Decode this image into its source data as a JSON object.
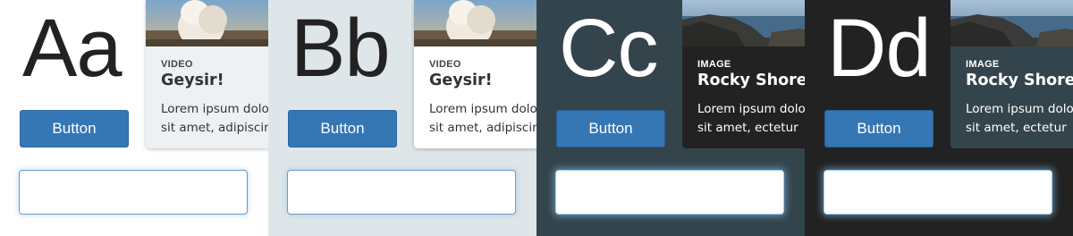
{
  "panels": [
    {
      "glyph": "Aa",
      "button_label": "Button",
      "card": {
        "kind": "VIDEO",
        "title": "Geysir!",
        "body_line1": "Lorem ipsum dolo",
        "body_line2": "sit amet, adipiscin",
        "image": "geyser-photo"
      },
      "colors": {
        "background": "#ffffff",
        "text": "#222222",
        "card_bg": "#eef1f4",
        "button": "#3576b5",
        "field_border": "#6a9cc9"
      }
    },
    {
      "glyph": "Bb",
      "button_label": "Button",
      "card": {
        "kind": "VIDEO",
        "title": "Geysir!",
        "body_line1": "Lorem ipsum dolo",
        "body_line2": "sit amet, adipiscin",
        "image": "geyser-photo"
      },
      "colors": {
        "background": "#dfe6ea",
        "text": "#222222",
        "card_bg": "#ffffff",
        "button": "#3576b5",
        "field_border": "#6a9cc9"
      }
    },
    {
      "glyph": "Cc",
      "button_label": "Button",
      "card": {
        "kind": "IMAGE",
        "title": "Rocky Shore",
        "body_line1": "Lorem ipsum dolo",
        "body_line2": "sit amet, ectetur",
        "image": "rocky-shore-photo"
      },
      "colors": {
        "background": "#34444c",
        "text": "#ffffff",
        "card_bg": "#222222",
        "button": "#3576b5",
        "field_border": "#9fd0f2"
      }
    },
    {
      "glyph": "Dd",
      "button_label": "Button",
      "card": {
        "kind": "IMAGE",
        "title": "Rocky Shore",
        "body_line1": "Lorem ipsum dolo",
        "body_line2": "sit amet, ectetur",
        "image": "rocky-shore-photo"
      },
      "colors": {
        "background": "#222222",
        "text": "#ffffff",
        "card_bg": "#34444c",
        "button": "#3576b5",
        "field_border": "#9fd0f2"
      }
    }
  ]
}
